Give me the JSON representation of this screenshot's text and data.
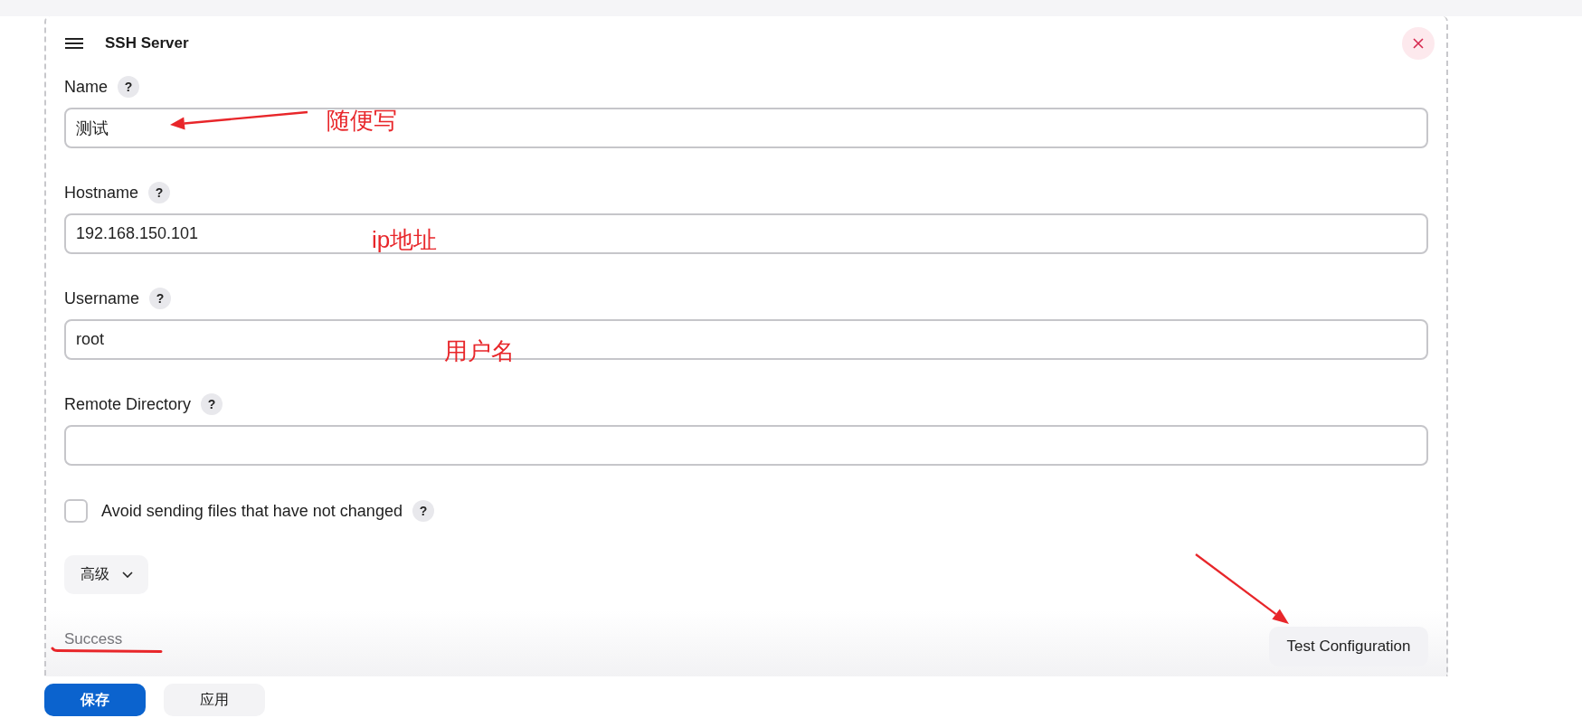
{
  "panel": {
    "title": "SSH Server"
  },
  "fields": [
    {
      "kind": "text",
      "label": "Name",
      "help": "?",
      "value": "测试",
      "annotation": {
        "text": "随便写",
        "arrow": true
      }
    },
    {
      "kind": "text",
      "label": "Hostname",
      "help": "?",
      "value": "192.168.150.101",
      "annotation": {
        "text": "ip地址",
        "arrow": false
      }
    },
    {
      "kind": "text",
      "label": "Username",
      "help": "?",
      "value": "root",
      "annotation": {
        "text": "用户名",
        "arrow": false
      }
    },
    {
      "kind": "text",
      "label": "Remote Directory",
      "help": "?"
    },
    {
      "kind": "checkbox",
      "label": "Avoid sending files that have not changed",
      "help": "?",
      "checked": false
    }
  ],
  "advanced_button": {
    "label": "高级"
  },
  "status": {
    "text": "Success",
    "underlined": true
  },
  "test_button": {
    "label": "Test Configuration",
    "arrow": true
  },
  "footer_buttons": [
    {
      "label": "保存",
      "kind": "primary"
    },
    {
      "label": "应用",
      "kind": "secondary"
    }
  ]
}
